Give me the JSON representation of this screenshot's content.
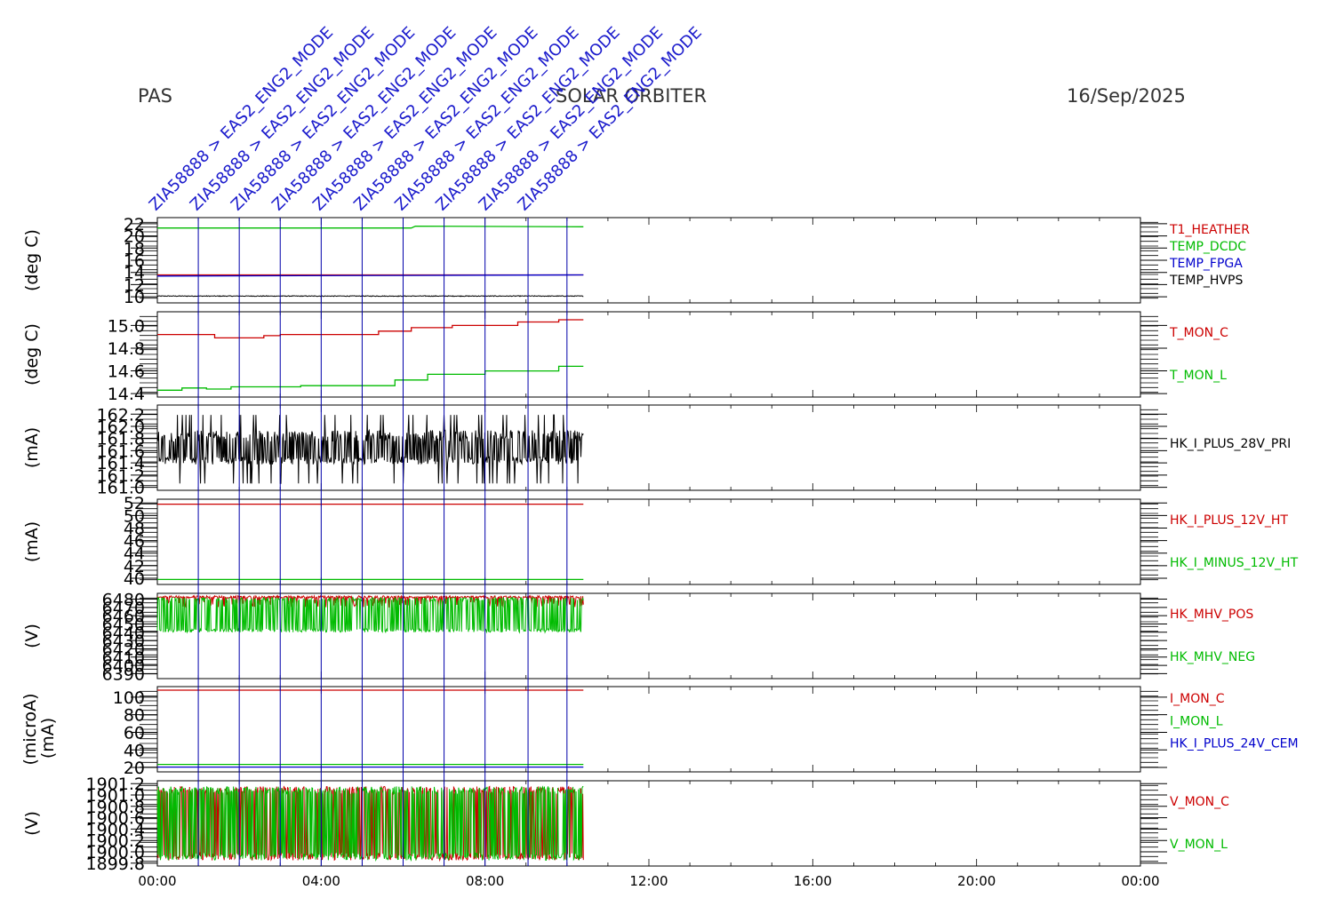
{
  "header": {
    "left": "PAS",
    "center": "SOLAR ORBITER",
    "right": "16/Sep/2025"
  },
  "chart_data": {
    "type": "line",
    "x_axis": {
      "range_hours": [
        0,
        24
      ],
      "ticks": [
        {
          "h": 0,
          "label": "00:00"
        },
        {
          "h": 4,
          "label": "04:00"
        },
        {
          "h": 8,
          "label": "08:00"
        },
        {
          "h": 12,
          "label": "12:00"
        },
        {
          "h": 16,
          "label": "16:00"
        },
        {
          "h": 20,
          "label": "20:00"
        },
        {
          "h": 24,
          "label": "00:00"
        }
      ],
      "data_end_hours": 10.4
    },
    "events": [
      {
        "h": 1.0,
        "label": "ZIA58888 > EAS2_ENG2_MODE"
      },
      {
        "h": 2.0,
        "label": "ZIA58888 > EAS2_ENG2_MODE"
      },
      {
        "h": 3.0,
        "label": "ZIA58888 > EAS2_ENG2_MODE"
      },
      {
        "h": 4.0,
        "label": "ZIA58888 > EAS2_ENG2_MODE"
      },
      {
        "h": 5.0,
        "label": "ZIA58888 > EAS2_ENG2_MODE"
      },
      {
        "h": 6.0,
        "label": "ZIA58888 > EAS2_ENG2_MODE"
      },
      {
        "h": 7.0,
        "label": "ZIA58888 > EAS2_ENG2_MODE"
      },
      {
        "h": 8.0,
        "label": "ZIA58888 > EAS2_ENG2_MODE"
      },
      {
        "h": 9.05,
        "label": "ZIA58888 > EAS2_ENG2_MODE"
      },
      {
        "h": 10.0,
        "label": "ZIA58888 > EAS2_ENG2_MODE"
      }
    ],
    "panels": [
      {
        "ylabel": "(deg C)",
        "ylabel2": "",
        "ylim": [
          9.0,
          23.0
        ],
        "ticks": [
          10,
          12,
          14,
          16,
          18,
          20,
          22
        ],
        "decimals": 0,
        "series": [
          {
            "name": "T1_HEATHER",
            "color": "#cc0000",
            "style": "flat",
            "values": [
              [
                0,
                13.6
              ],
              [
                10.4,
                13.6
              ]
            ]
          },
          {
            "name": "TEMP_DCDC",
            "color": "#00bb00",
            "style": "flat",
            "values": [
              [
                0,
                21.3
              ],
              [
                6.2,
                21.3
              ],
              [
                6.3,
                21.6
              ],
              [
                10.4,
                21.5
              ]
            ]
          },
          {
            "name": "TEMP_FPGA",
            "color": "#0000cc",
            "style": "flat",
            "values": [
              [
                0,
                13.4
              ],
              [
                6.0,
                13.5
              ],
              [
                10.4,
                13.6
              ]
            ]
          },
          {
            "name": "TEMP_HVPS",
            "color": "#000000",
            "style": "noisy",
            "range": [
              9.9,
              10.3
            ]
          }
        ]
      },
      {
        "ylabel": "(deg C)",
        "ylabel2": "",
        "ylim": [
          14.37,
          15.12
        ],
        "ticks": [
          14.4,
          14.6,
          14.8,
          15.0
        ],
        "decimals": 1,
        "series": [
          {
            "name": "T_MON_C",
            "color": "#cc0000",
            "style": "step",
            "values": [
              [
                0,
                14.92
              ],
              [
                1.4,
                14.89
              ],
              [
                2.6,
                14.91
              ],
              [
                3.0,
                14.92
              ],
              [
                5.4,
                14.95
              ],
              [
                6.2,
                14.98
              ],
              [
                7.2,
                15.0
              ],
              [
                8.8,
                15.03
              ],
              [
                9.8,
                15.05
              ]
            ]
          },
          {
            "name": "T_MON_L",
            "color": "#00bb00",
            "style": "step",
            "values": [
              [
                0,
                14.43
              ],
              [
                0.6,
                14.45
              ],
              [
                1.2,
                14.44
              ],
              [
                1.8,
                14.46
              ],
              [
                3.5,
                14.47
              ],
              [
                5.8,
                14.52
              ],
              [
                6.6,
                14.57
              ],
              [
                8.0,
                14.6
              ],
              [
                9.8,
                14.64
              ]
            ]
          }
        ]
      },
      {
        "ylabel": "(mA)",
        "ylabel2": "",
        "ylim": [
          160.95,
          162.35
        ],
        "ticks": [
          161.0,
          161.2,
          161.4,
          161.6,
          161.8,
          162.0,
          162.2
        ],
        "decimals": 1,
        "series": [
          {
            "name": "HK_I_PLUS_28V_PRI",
            "color": "#000000",
            "style": "noisy",
            "range": [
              161.0,
              162.25
            ]
          }
        ]
      },
      {
        "ylabel": "(mA)",
        "ylabel2": "",
        "ylim": [
          39.0,
          52.6
        ],
        "ticks": [
          40,
          42,
          44,
          46,
          48,
          50,
          52
        ],
        "decimals": 0,
        "series": [
          {
            "name": "HK_I_PLUS_12V_HT",
            "color": "#cc0000",
            "style": "flat",
            "values": [
              [
                0,
                51.8
              ],
              [
                10.4,
                51.8
              ]
            ]
          },
          {
            "name": "HK_I_MINUS_12V_HT",
            "color": "#00bb00",
            "style": "flat",
            "values": [
              [
                0,
                39.8
              ],
              [
                10.4,
                39.8
              ]
            ]
          }
        ]
      },
      {
        "ylabel": "(V)",
        "ylabel2": "",
        "ylim": [
          6384,
          6487
        ],
        "ticks": [
          6390,
          6400,
          6410,
          6420,
          6430,
          6440,
          6450,
          6460,
          6470,
          6480
        ],
        "decimals": 0,
        "series": [
          {
            "name": "HK_MHV_POS",
            "color": "#cc0000",
            "style": "noisy",
            "range": [
              6470,
              6484
            ]
          },
          {
            "name": "HK_MHV_NEG",
            "color": "#00bb00",
            "style": "noisy",
            "range": [
              6440,
              6482
            ]
          }
        ]
      },
      {
        "ylabel": "(microA)",
        "ylabel2": "(mA)",
        "ylim": [
          15,
          112
        ],
        "ticks": [
          20,
          40,
          60,
          80,
          100
        ],
        "decimals": 0,
        "series": [
          {
            "name": "I_MON_C",
            "color": "#cc0000",
            "style": "flat",
            "values": [
              [
                0,
                108
              ],
              [
                10.4,
                108
              ]
            ]
          },
          {
            "name": "I_MON_L",
            "color": "#00bb00",
            "style": "flat",
            "values": [
              [
                0,
                23.5
              ],
              [
                10.4,
                23.5
              ]
            ]
          },
          {
            "name": "HK_I_PLUS_24V_CEM",
            "color": "#0000cc",
            "style": "flat",
            "values": [
              [
                0,
                20.5
              ],
              [
                10.4,
                20.5
              ]
            ]
          }
        ]
      },
      {
        "ylabel": "(V)",
        "ylabel2": "",
        "ylim": [
          1899.75,
          1901.25
        ],
        "ticks": [
          1899.8,
          1900.0,
          1900.2,
          1900.4,
          1900.6,
          1900.8,
          1901.0,
          1901.2
        ],
        "decimals": 1,
        "series": [
          {
            "name": "V_MON_C",
            "color": "#cc0000",
            "style": "noisy",
            "range": [
              1899.85,
              1901.15
            ]
          },
          {
            "name": "V_MON_L",
            "color": "#00bb00",
            "style": "noisy",
            "range": [
              1899.85,
              1901.15
            ]
          }
        ]
      }
    ]
  }
}
